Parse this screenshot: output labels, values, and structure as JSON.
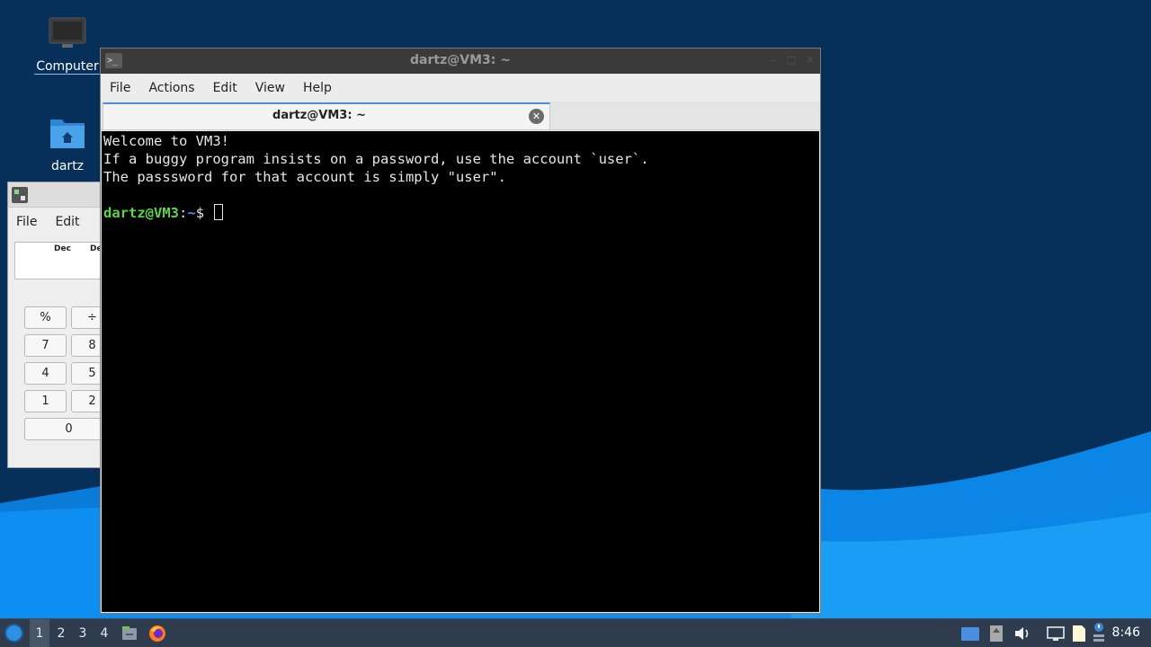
{
  "desktop": {
    "icons": [
      {
        "label": "Computer"
      },
      {
        "label": "dartz"
      }
    ]
  },
  "calculator": {
    "menu": [
      "File",
      "Edit"
    ],
    "display_labels": [
      "Dec",
      "De"
    ],
    "buttons": [
      "%",
      "÷",
      "7",
      "8",
      "4",
      "5",
      "1",
      "2",
      "0"
    ]
  },
  "terminal": {
    "window_title": "dartz@VM3: ~",
    "menu": [
      "File",
      "Actions",
      "Edit",
      "View",
      "Help"
    ],
    "tab_title": "dartz@VM3: ~",
    "lines": [
      "Welcome to VM3!",
      "If a buggy program insists on a password, use the account `user`.",
      "The passsword for that account is simply \"user\"."
    ],
    "prompt": {
      "user_host": "dartz@VM3",
      "separator": ":",
      "dir": "~",
      "symbol": "$"
    }
  },
  "taskbar": {
    "workspaces": [
      "1",
      "2",
      "3",
      "4"
    ],
    "active_workspace": "1",
    "clock": "8:46"
  },
  "colors": {
    "desktop_bg": "#06305a",
    "wave": "#0b86e6",
    "terminal_bg": "#000000",
    "prompt_user": "#5ad646",
    "prompt_dir": "#5b8de6",
    "taskbar": "#2f3c4e"
  }
}
